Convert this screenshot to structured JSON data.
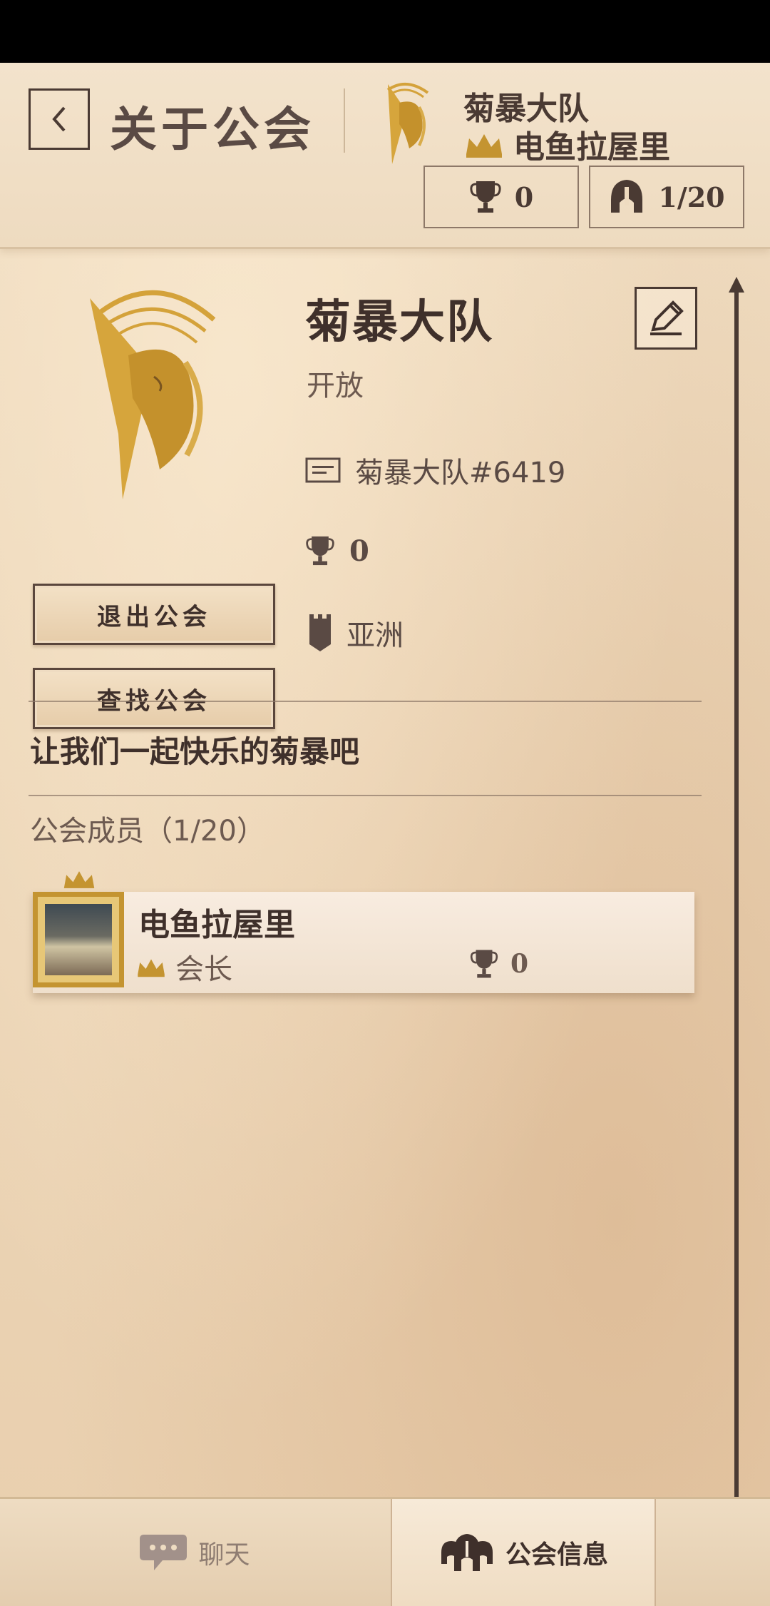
{
  "header": {
    "title": "关于公会",
    "guild_name": "菊暴大队",
    "leader_name": "电鱼拉屋里",
    "trophies": "0",
    "members": "1/20"
  },
  "guild": {
    "name": "菊暴大队",
    "status": "开放",
    "tag": "菊暴大队#6419",
    "trophies": "0",
    "region": "亚洲",
    "description": "让我们一起快乐的菊暴吧"
  },
  "actions": {
    "leave_label": "退出公会",
    "find_label": "查找公会"
  },
  "members_section": {
    "label": "公会成员（1/20）",
    "members": [
      {
        "name": "电鱼拉屋里",
        "role": "会长",
        "trophies": "0"
      }
    ]
  },
  "tabs": {
    "chat_label": "聊天",
    "info_label": "公会信息"
  },
  "colors": {
    "accent_gold": "#c49431",
    "text_dark": "#3f302b",
    "paper": "#eedbc0"
  },
  "icons": [
    "back-arrow-icon",
    "unicorn-emblem-icon",
    "crown-icon",
    "trophy-icon",
    "helmet-icon",
    "edit-pencil-icon",
    "id-card-icon",
    "tower-icon",
    "chat-bubble-icon",
    "guild-helmets-icon"
  ]
}
